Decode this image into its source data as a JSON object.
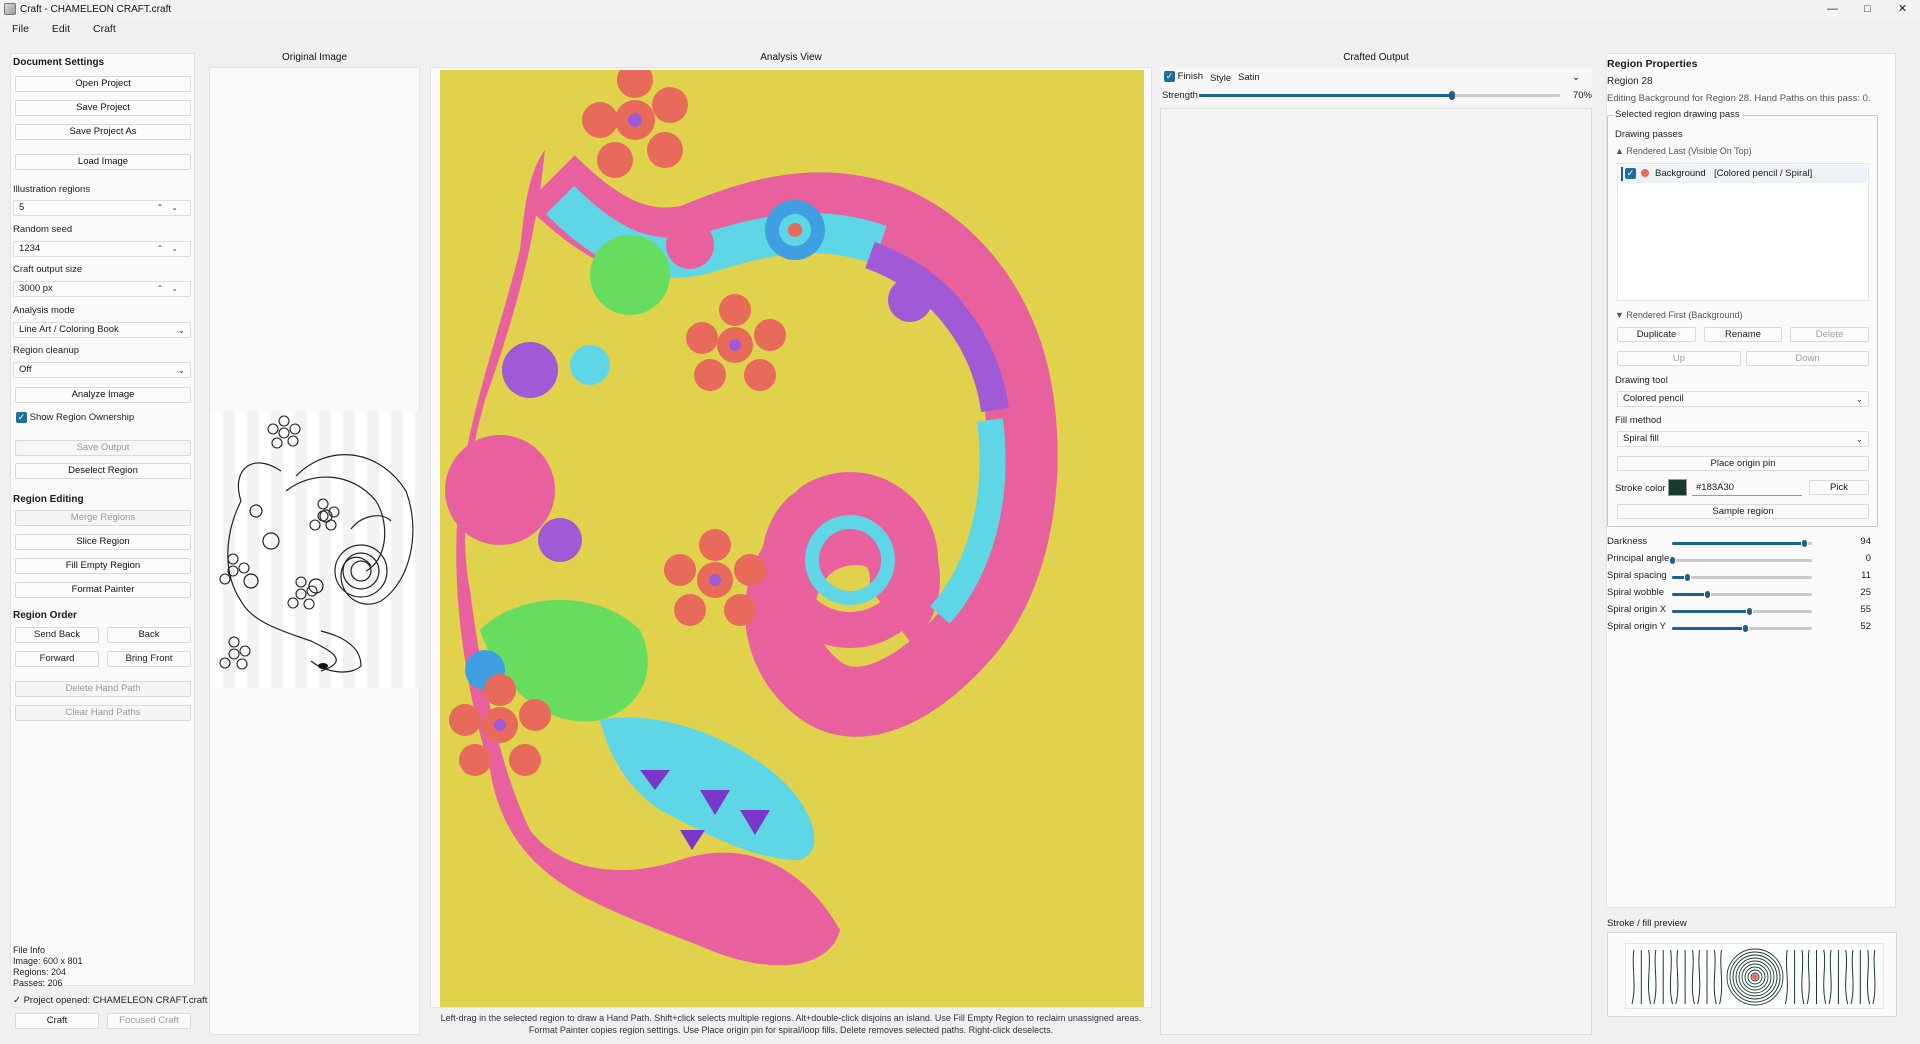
{
  "window": {
    "title": "Craft - CHAMELEON CRAFT.craft",
    "controls": [
      "—",
      "□",
      "✕"
    ]
  },
  "menu": [
    "File",
    "Edit",
    "Craft"
  ],
  "left": {
    "document_settings": "Document Settings",
    "open_project": "Open Project",
    "save_project": "Save Project",
    "save_project_as": "Save Project As",
    "load_image": "Load Image",
    "illustration_regions_label": "Illustration regions",
    "illustration_regions_value": "5",
    "random_seed_label": "Random seed",
    "random_seed_value": "1234",
    "craft_output_size_label": "Craft output size",
    "craft_output_size_value": "3000 px",
    "analysis_mode_label": "Analysis mode",
    "analysis_mode_value": "Line Art / Coloring Book",
    "region_cleanup_label": "Region cleanup",
    "region_cleanup_value": "Off",
    "analyze_image": "Analyze Image",
    "show_region_ownership": "Show Region Ownership",
    "save_output": "Save Output",
    "deselect_region": "Deselect Region",
    "region_editing": "Region Editing",
    "merge_regions": "Merge Regions",
    "slice_region": "Slice Region",
    "fill_empty_region": "Fill Empty Region",
    "format_painter": "Format Painter",
    "region_order": "Region Order",
    "send_back": "Send Back",
    "back": "Back",
    "forward": "Forward",
    "bring_front": "Bring Front",
    "delete_hand_path": "Delete Hand Path",
    "clear_hand_paths": "Clear Hand Paths",
    "file_info": [
      "File Info",
      "Image: 600 x 801",
      "Regions: 204",
      "Passes: 206"
    ],
    "status": "✓ Project opened: CHAMELEON CRAFT.craft",
    "craft": "Craft",
    "focused_craft": "Focused Craft"
  },
  "columns": {
    "original": "Original Image",
    "analysis": "Analysis View",
    "crafted": "Crafted Output"
  },
  "hint": "Left-drag in the selected region to draw a Hand Path. Shift+click selects multiple regions. Alt+double-click disjoins an island. Use Fill Empty Region to reclaim unassigned areas. Format Painter copies region settings. Use Place origin pin for spiral/loop fills. Delete removes selected paths. Right-click deselects.",
  "crafted": {
    "finish_label": "Finish",
    "style_label": "Style",
    "style_value": "Satin",
    "strength_label": "Strength",
    "strength_value": "70%",
    "strength_level": 0.7
  },
  "right": {
    "title": "Region Properties",
    "region": "Region 28",
    "editing": "Editing Background for Region 28. Hand Paths on this pass: 0.",
    "selected_pass_group": "Selected region drawing pass",
    "drawing_passes": "Drawing passes",
    "rendered_last": "▲ Rendered Last (Visible On Top)",
    "pass_name": "Background",
    "pass_detail": "[Colored pencil / Spiral]",
    "rendered_first": "▼ Rendered First (Background)",
    "duplicate": "Duplicate",
    "rename": "Rename",
    "delete": "Delete",
    "up": "Up",
    "down": "Down",
    "drawing_tool_label": "Drawing tool",
    "drawing_tool_value": "Colored pencil",
    "fill_method_label": "Fill method",
    "fill_method_value": "Spiral fill",
    "place_origin_pin": "Place origin pin",
    "stroke_color_label": "Stroke color",
    "stroke_color_hex": "#183A30",
    "stroke_color": "#183a30",
    "pick": "Pick",
    "sample_region": "Sample region",
    "sliders": [
      {
        "label": "Darkness",
        "value": "94",
        "level": 0.94
      },
      {
        "label": "Principal angle",
        "value": "0",
        "level": 0.0
      },
      {
        "label": "Spiral spacing",
        "value": "11",
        "level": 0.11
      },
      {
        "label": "Spiral wobble",
        "value": "25",
        "level": 0.25
      },
      {
        "label": "Spiral origin X",
        "value": "55",
        "level": 0.55
      },
      {
        "label": "Spiral origin Y",
        "value": "52",
        "level": 0.52
      }
    ],
    "preview_title": "Stroke / fill preview"
  },
  "colors": {
    "accent": "#1f5f8b",
    "canvas_bg": "#e1d24e",
    "pink": "#e8609e",
    "cyan": "#5fd6e6",
    "green": "#67dc5f",
    "purple": "#a05ad6",
    "orange": "#e86a5a"
  }
}
